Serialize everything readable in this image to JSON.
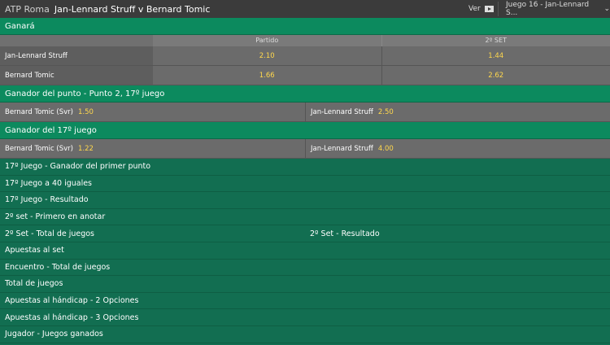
{
  "header": {
    "competition": "ATP Roma",
    "match": "Jan-Lennard Struff v Bernard Tomic",
    "view_label": "Ver",
    "game_selector": "Juego 16 - Jan-Lennard S..."
  },
  "winner": {
    "title": "Ganará",
    "columns": [
      "Partido",
      "2º SET"
    ],
    "rows": [
      {
        "name": "Jan-Lennard Struff",
        "odds": [
          "2.10",
          "1.44"
        ]
      },
      {
        "name": "Bernard Tomic",
        "odds": [
          "1.66",
          "2.62"
        ]
      }
    ]
  },
  "point_winner": {
    "title": "Ganador del punto - Punto 2, 17º juego",
    "left": {
      "name": "Bernard Tomic (Svr)",
      "odd": "1.50"
    },
    "right": {
      "name": "Jan-Lennard Struff",
      "odd": "2.50"
    }
  },
  "game_winner": {
    "title": "Ganador del 17º juego",
    "left": {
      "name": "Bernard Tomic (Svr)",
      "odd": "1.22"
    },
    "right": {
      "name": "Jan-Lennard Struff",
      "odd": "4.00"
    }
  },
  "markets": [
    {
      "left": "17º Juego - Ganador del primer punto",
      "right": ""
    },
    {
      "left": "17º Juego a 40 iguales",
      "right": ""
    },
    {
      "left": "17º Juego - Resultado",
      "right": ""
    },
    {
      "left": "2º set - Primero en anotar",
      "right": ""
    },
    {
      "left": "2º Set - Total de juegos",
      "right": "2º Set - Resultado"
    },
    {
      "left": "Apuestas al set",
      "right": ""
    },
    {
      "left": "Encuentro - Total de juegos",
      "right": ""
    },
    {
      "left": "Total de juegos",
      "right": ""
    },
    {
      "left": "Apuestas al hándicap - 2 Opciones",
      "right": ""
    },
    {
      "left": "Apuestas al hándicap - 3 Opciones",
      "right": ""
    },
    {
      "left": "Jugador - Juegos ganados",
      "right": ""
    }
  ],
  "colors": {
    "accent": "#126e51",
    "odds": "#ffd84d",
    "header_bg": "#3b3b3b"
  }
}
